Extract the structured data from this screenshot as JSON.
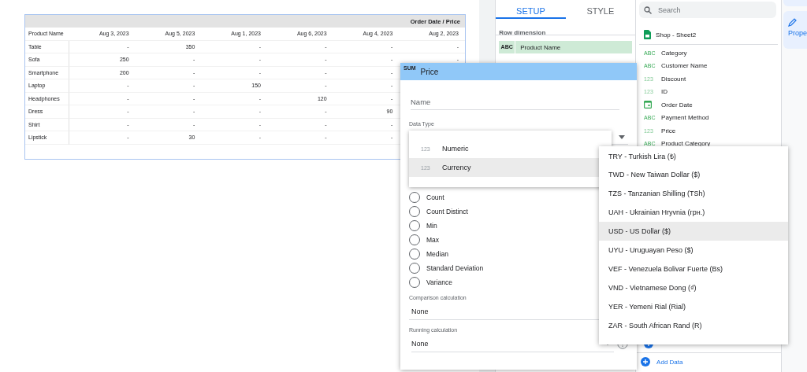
{
  "report_table": {
    "header": "Order Date / Price",
    "columns": [
      "Product Name",
      "Aug 3, 2023",
      "Aug 5, 2023",
      "Aug 1, 2023",
      "Aug 6, 2023",
      "Aug 4, 2023",
      "Aug 2, 2023"
    ],
    "rows": [
      {
        "cells": [
          "Table",
          "-",
          "350",
          "-",
          "-",
          "-",
          "-"
        ]
      },
      {
        "cells": [
          "Sofa",
          "250",
          "-",
          "-",
          "-",
          "-",
          "-"
        ]
      },
      {
        "cells": [
          "Smartphone",
          "200",
          "-",
          "-",
          "-",
          "-"
        ]
      },
      {
        "cells": [
          "Laptop",
          "-",
          "-",
          "150",
          "-",
          "-"
        ]
      },
      {
        "cells": [
          "Headphones",
          "-",
          "-",
          "-",
          "120",
          "-"
        ]
      },
      {
        "cells": [
          "Dress",
          "-",
          "-",
          "-",
          "-",
          "90"
        ]
      },
      {
        "cells": [
          "Shirt",
          "-",
          "-",
          "-",
          "-",
          "-"
        ]
      },
      {
        "cells": [
          "Lipstick",
          "-",
          "30",
          "-",
          "-",
          "-"
        ]
      }
    ]
  },
  "setup_panel": {
    "tabs": [
      {
        "label": "SETUP",
        "selected": true
      },
      {
        "label": "STYLE",
        "selected": false
      }
    ],
    "row_dimension_label": "Row dimension",
    "row_dimension": {
      "badge": "ABC",
      "name": "Product Name"
    }
  },
  "data_panel": {
    "search": {
      "placeholder": "Search"
    },
    "source": "Shop - Sheet2",
    "fields": [
      {
        "kind": "text",
        "badge": "ABC",
        "name": "Category"
      },
      {
        "kind": "text",
        "badge": "ABC",
        "name": "Customer Name"
      },
      {
        "kind": "number",
        "badge": "123",
        "name": "Discount"
      },
      {
        "kind": "number",
        "badge": "123",
        "name": "ID"
      },
      {
        "kind": "date",
        "name": "Order Date"
      },
      {
        "kind": "text",
        "badge": "ABC",
        "name": "Payment Method"
      },
      {
        "kind": "number",
        "badge": "123",
        "name": "Price"
      },
      {
        "kind": "text",
        "badge": "ABC",
        "name": "Product Category"
      }
    ],
    "add_data": "Add Data"
  },
  "side_strip": {
    "properties_label": "Prope"
  },
  "field_dialog": {
    "badge": "SUM",
    "title": "Price",
    "name_field": {
      "placeholder": "Name"
    },
    "data_type_label": "Data Type",
    "aggregations": [
      {
        "label": "Count",
        "selected": false
      },
      {
        "label": "Count Distinct",
        "selected": false
      },
      {
        "label": "Min",
        "selected": false
      },
      {
        "label": "Max",
        "selected": false
      },
      {
        "label": "Median",
        "selected": false
      },
      {
        "label": "Standard Deviation",
        "selected": false
      },
      {
        "label": "Variance",
        "selected": false
      }
    ],
    "comparison_label": "Comparison calculation",
    "comparison_value": "None",
    "running_label": "Running calculation",
    "running_value": "None"
  },
  "type_menu": {
    "items": [
      {
        "badge": "123",
        "label": "Numeric",
        "selected": false
      },
      {
        "badge": "123",
        "label": "Currency",
        "selected": true
      }
    ]
  },
  "currency_menu": {
    "items": [
      {
        "label": "TRY - Turkish Lira (₺)",
        "selected": false
      },
      {
        "label": "TWD - New Taiwan Dollar ($)",
        "selected": false
      },
      {
        "label": "TZS - Tanzanian Shilling (TSh)",
        "selected": false
      },
      {
        "label": "UAH - Ukrainian Hryvnia (грн.)",
        "selected": false
      },
      {
        "label": "USD - US Dollar ($)",
        "selected": true
      },
      {
        "label": "UYU - Uruguayan Peso ($)",
        "selected": false
      },
      {
        "label": "VEF - Venezuela Bolivar Fuerte (Bs)",
        "selected": false
      },
      {
        "label": "VND - Vietnamese Dong (₫)",
        "selected": false
      },
      {
        "label": "YER - Yemeni Rial (Rial)",
        "selected": false
      },
      {
        "label": "ZAR - South African Rand (R)",
        "selected": false
      }
    ]
  }
}
